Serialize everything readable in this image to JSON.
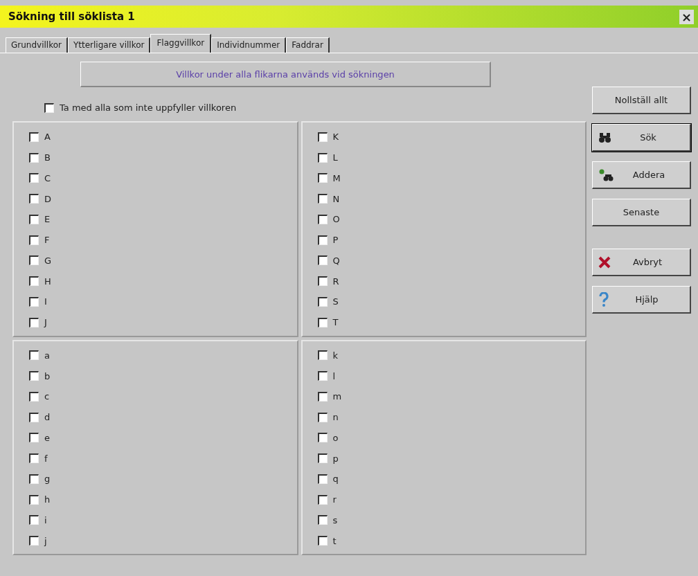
{
  "window": {
    "title": "Sökning till söklista 1",
    "close": "×"
  },
  "tabs": [
    {
      "label": "Grundvillkor",
      "selected": false
    },
    {
      "label": "Ytterligare villkor",
      "selected": false
    },
    {
      "label": "Flaggvillkor",
      "selected": true
    },
    {
      "label": "Individnummer",
      "selected": false
    },
    {
      "label": "Faddrar",
      "selected": false
    }
  ],
  "banner": "Villkor under alla flikarna används vid sökningen",
  "include_all": {
    "label": "Ta med alla som inte uppfyller villkoren",
    "checked": false
  },
  "groups": [
    {
      "items": [
        {
          "label": "A",
          "checked": false
        },
        {
          "label": "B",
          "checked": false
        },
        {
          "label": "C",
          "checked": false
        },
        {
          "label": "D",
          "checked": false
        },
        {
          "label": "E",
          "checked": false
        },
        {
          "label": "F",
          "checked": false
        },
        {
          "label": "G",
          "checked": false
        },
        {
          "label": "H",
          "checked": false
        },
        {
          "label": "I",
          "checked": false
        },
        {
          "label": "J",
          "checked": false
        }
      ]
    },
    {
      "items": [
        {
          "label": "K",
          "checked": false
        },
        {
          "label": "L",
          "checked": false
        },
        {
          "label": "M",
          "checked": false
        },
        {
          "label": "N",
          "checked": false
        },
        {
          "label": "O",
          "checked": false
        },
        {
          "label": "P",
          "checked": false
        },
        {
          "label": "Q",
          "checked": false
        },
        {
          "label": "R",
          "checked": false
        },
        {
          "label": "S",
          "checked": false
        },
        {
          "label": "T",
          "checked": false
        }
      ]
    },
    {
      "items": [
        {
          "label": "a",
          "checked": false
        },
        {
          "label": "b",
          "checked": false
        },
        {
          "label": "c",
          "checked": false
        },
        {
          "label": "d",
          "checked": false
        },
        {
          "label": "e",
          "checked": false
        },
        {
          "label": "f",
          "checked": false
        },
        {
          "label": "g",
          "checked": false
        },
        {
          "label": "h",
          "checked": false
        },
        {
          "label": "i",
          "checked": false
        },
        {
          "label": "j",
          "checked": false
        }
      ]
    },
    {
      "items": [
        {
          "label": "k",
          "checked": false
        },
        {
          "label": "l",
          "checked": false
        },
        {
          "label": "m",
          "checked": false
        },
        {
          "label": "n",
          "checked": false
        },
        {
          "label": "o",
          "checked": false
        },
        {
          "label": "p",
          "checked": false
        },
        {
          "label": "q",
          "checked": false
        },
        {
          "label": "r",
          "checked": false
        },
        {
          "label": "s",
          "checked": false
        },
        {
          "label": "t",
          "checked": false
        }
      ]
    }
  ],
  "button_groups": [
    [
      {
        "label": "Nollställ allt",
        "kind": "plain"
      },
      {
        "label": "Sök",
        "kind": "search",
        "default": true
      },
      {
        "label": "Addera",
        "kind": "add"
      },
      {
        "label": "Senaste",
        "kind": "plain"
      }
    ],
    [
      {
        "label": "Avbryt",
        "kind": "cancel"
      },
      {
        "label": "Hjälp",
        "kind": "help"
      }
    ]
  ]
}
